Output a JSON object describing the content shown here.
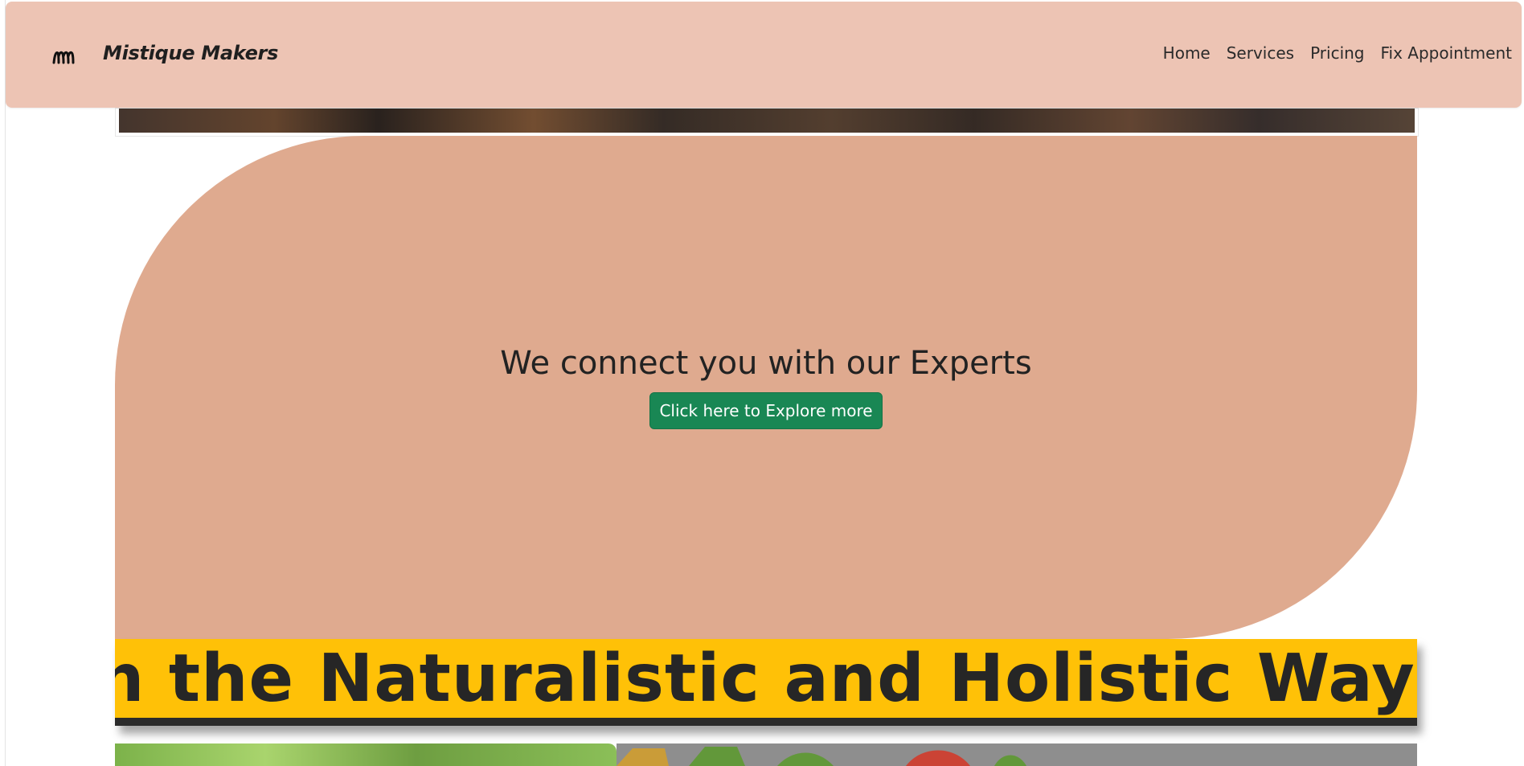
{
  "brand": {
    "logo_icon": "mm-script-logo-icon",
    "name": "Mistique Makers"
  },
  "nav": {
    "items": [
      {
        "label": "Home"
      },
      {
        "label": "Services"
      },
      {
        "label": "Pricing"
      },
      {
        "label": "Fix Appointment"
      }
    ]
  },
  "hero": {
    "heading": "We connect you with our Experts",
    "button_label": "Click here to Explore more"
  },
  "banner": {
    "text": "n the Naturalistic and Holistic Way"
  },
  "colors": {
    "navbar_bg": "#edc4b4",
    "section_bg": "#dfaa8f",
    "button_bg": "#198754",
    "banner_bg": "#ffc107"
  }
}
